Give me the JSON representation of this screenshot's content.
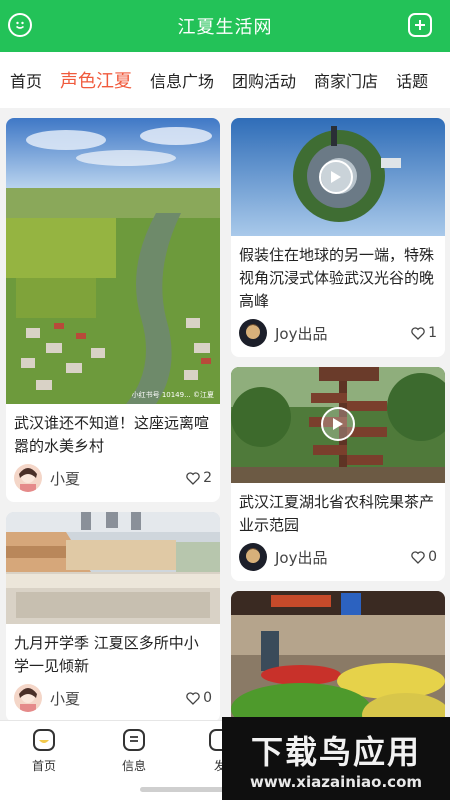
{
  "header": {
    "title": "江夏生活网",
    "left_icon": "smiley-icon",
    "right_icon": "add-square-icon"
  },
  "tabs": [
    {
      "label": "首页",
      "active": false
    },
    {
      "label": "声色江夏",
      "active": true
    },
    {
      "label": "信息广场",
      "active": false
    },
    {
      "label": "团购活动",
      "active": false
    },
    {
      "label": "商家门店",
      "active": false
    },
    {
      "label": "话题",
      "active": false
    }
  ],
  "colors": {
    "primary": "#23c258",
    "active_tab": "#f05a3c"
  },
  "feed": {
    "left": [
      {
        "title": "武汉谁还不知道！这座远离喧嚣的水美乡村",
        "author": "小夏",
        "likes": "2",
        "thumb_watermark": "小红书号 10149... ©江夏"
      },
      {
        "title": "九月开学季 江夏区多所中小学一见倾新",
        "author": "小夏",
        "likes": "0"
      }
    ],
    "right": [
      {
        "title": "假装住在地球的另一端，特殊视角沉浸式体验武汉光谷的晚高峰",
        "author": "Joy出品",
        "likes": "1"
      },
      {
        "title": "武汉江夏湖北省农科院果茶产业示范园",
        "author": "Joy出品",
        "likes": "0"
      },
      {
        "title": "",
        "author": "",
        "likes": ""
      }
    ]
  },
  "bottom_nav": [
    {
      "label": "首页",
      "icon": "home-face-icon"
    },
    {
      "label": "信息",
      "icon": "info-list-icon"
    },
    {
      "label": "发",
      "icon": "publish-icon"
    }
  ],
  "watermark": {
    "title": "下载鸟应用",
    "url": "www.xiazainiao.com"
  }
}
